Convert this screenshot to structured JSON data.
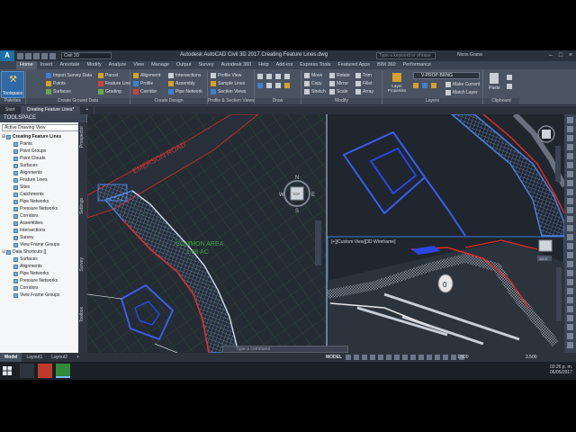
{
  "app": {
    "logo_letter": "A",
    "workspace": "Civil 3D",
    "title": "Autodesk AutoCAD Civil 3D 2017    Creating Feature Lines.dwg",
    "search_placeholder": "Type a keyword or phrase",
    "user": "Nicos Grana"
  },
  "menu_tabs": [
    "Home",
    "Insert",
    "Annotate",
    "Modify",
    "Analyze",
    "View",
    "Manage",
    "Output",
    "Survey",
    "Autodesk 360",
    "Help",
    "Add-ins",
    "Express Tools",
    "Featured Apps",
    "BIM 360",
    "Performance"
  ],
  "ribbon": {
    "toolspace": "Toolspace",
    "palettes": "Palettes",
    "create_ground_data": {
      "title": "Create Ground Data",
      "items": [
        "Import Survey Data",
        "Points",
        "Surfaces"
      ]
    },
    "ground_extra": [
      "Parcel",
      "Feature Line",
      "Grading"
    ],
    "create_design": {
      "title": "Create Design",
      "items": [
        "Alignment",
        "Profile",
        "Corridor",
        "Intersections",
        "Assembly",
        "Pipe Network"
      ]
    },
    "profile_section": {
      "title": "Profile & Section Views",
      "items": [
        "Profile View",
        "Sample Lines",
        "Section Views"
      ]
    },
    "draw": {
      "title": "Draw"
    },
    "modify": {
      "title": "Modify",
      "items": [
        "Move",
        "Copy",
        "Stretch",
        "Rotate",
        "Mirror",
        "Scale",
        "Trim",
        "Fillet",
        "Array"
      ]
    },
    "layers": {
      "title": "Layers",
      "current": "V-PROP-BRNG",
      "layer_properties": "Layer Properties",
      "items": [
        "Make Current",
        "Match Layer"
      ]
    },
    "clipboard": {
      "title": "Clipboard",
      "paste": "Paste"
    }
  },
  "file_tabs": [
    "Start",
    "Creating Feature Lines*"
  ],
  "toolspace": {
    "header": "TOOLSPACE",
    "view": "Active Drawing View",
    "tree": [
      {
        "label": "Creating Feature Lines",
        "level": 0,
        "bold": true
      },
      {
        "label": "Points",
        "level": 1
      },
      {
        "label": "Point Groups",
        "level": 1
      },
      {
        "label": "Point Clouds",
        "level": 1
      },
      {
        "label": "Surfaces",
        "level": 1
      },
      {
        "label": "Alignments",
        "level": 1
      },
      {
        "label": "Feature Lines",
        "level": 1
      },
      {
        "label": "Sites",
        "level": 1
      },
      {
        "label": "Catchments",
        "level": 1
      },
      {
        "label": "Pipe Networks",
        "level": 1
      },
      {
        "label": "Pressure Networks",
        "level": 1
      },
      {
        "label": "Corridors",
        "level": 1
      },
      {
        "label": "Assemblies",
        "level": 1
      },
      {
        "label": "Intersections",
        "level": 1
      },
      {
        "label": "Survey",
        "level": 1
      },
      {
        "label": "View Frame Groups",
        "level": 1
      },
      {
        "label": "Data Shortcuts []",
        "level": 0
      },
      {
        "label": "Surfaces",
        "level": 1
      },
      {
        "label": "Alignments",
        "level": 1
      },
      {
        "label": "Pipe Networks",
        "level": 1
      },
      {
        "label": "Pressure Networks",
        "level": 1
      },
      {
        "label": "Corridors",
        "level": 1
      },
      {
        "label": "View Frame Groups",
        "level": 1
      }
    ],
    "side_tabs": [
      "Prospector",
      "Settings",
      "Survey",
      "Toolbox"
    ]
  },
  "viewports": {
    "road_label": "EMERSON ROAD",
    "common_area": "COMMON AREA",
    "common_area_size": "1.95 AC",
    "view3d_label": "[+][Custom View][3D Wireframe]",
    "viewcube_label": "WCS",
    "compass_n": "N",
    "compass_s": "S",
    "compass_w": "W",
    "compass_e": "E",
    "cube_top": "TOP"
  },
  "command_line_placeholder": "Type a command",
  "status_bar": {
    "layout_tabs": [
      "Model",
      "Layout1",
      "Layout2"
    ],
    "model": "MODEL",
    "scale": "1:500",
    "value": "3.500"
  },
  "tray": {
    "time": "03:26 p. m.",
    "date": "06/05/2017"
  },
  "colors": {
    "corridor_blue": "#4a7fe0",
    "edge_red": "#e02a2a",
    "grid_green": "#3f8a3f",
    "lot_blue": "#2846e6",
    "dark_bg": "#212830"
  }
}
